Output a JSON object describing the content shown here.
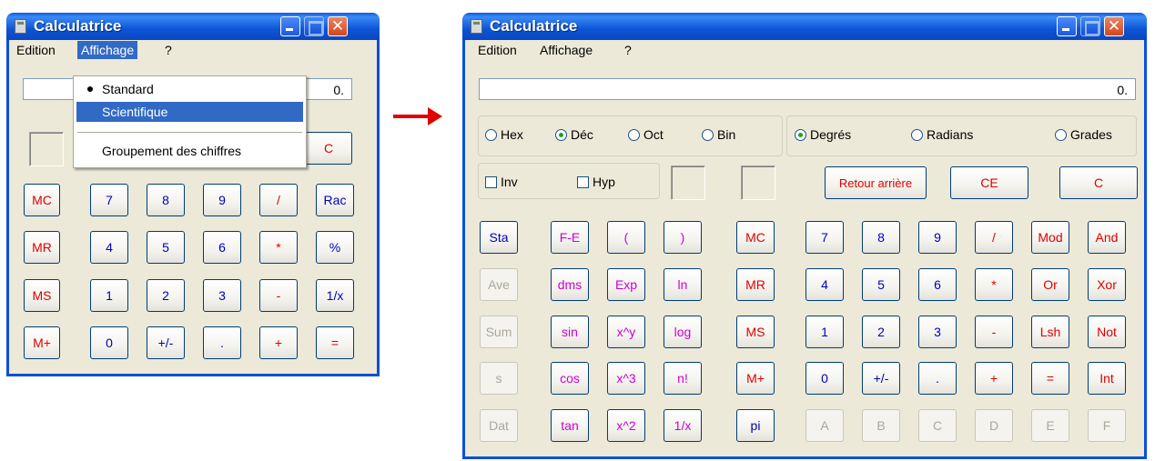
{
  "left": {
    "title": "Calculatrice",
    "menu": [
      "Edition",
      "Affichage",
      "?"
    ],
    "display": "0.",
    "clear": "C",
    "dropdown": {
      "items": [
        "Standard",
        "Scientifique",
        "Groupement des chiffres"
      ]
    },
    "rows": [
      [
        "MC",
        "7",
        "8",
        "9",
        "/",
        "Rac"
      ],
      [
        "MR",
        "4",
        "5",
        "6",
        "*",
        "%"
      ],
      [
        "MS",
        "1",
        "2",
        "3",
        "-",
        "1/x"
      ],
      [
        "M+",
        "0",
        "+/-",
        ".",
        "+",
        "="
      ]
    ]
  },
  "right": {
    "title": "Calculatrice",
    "menu": [
      "Edition",
      "Affichage",
      "?"
    ],
    "display": "0.",
    "bases": [
      "Hex",
      "Déc",
      "Oct",
      "Bin"
    ],
    "angles": [
      "Degrés",
      "Radians",
      "Grades"
    ],
    "inv": "Inv",
    "hyp": "Hyp",
    "back": "Retour arrière",
    "ce": "CE",
    "c": "C",
    "stat": [
      "Sta",
      "Ave",
      "Sum",
      "s",
      "Dat"
    ],
    "fcol1": [
      "F-E",
      "dms",
      "sin",
      "cos",
      "tan"
    ],
    "fcol2": [
      "(",
      "Exp",
      "x^y",
      "x^3",
      "x^2"
    ],
    "fcol3": [
      ")",
      "ln",
      "log",
      "n!",
      "1/x"
    ],
    "mem": [
      "MC",
      "MR",
      "MS",
      "M+",
      "pi"
    ],
    "pad": [
      [
        "7",
        "8",
        "9",
        "/",
        "Mod",
        "And"
      ],
      [
        "4",
        "5",
        "6",
        "*",
        "Or",
        "Xor"
      ],
      [
        "1",
        "2",
        "3",
        "-",
        "Lsh",
        "Not"
      ],
      [
        "0",
        "+/-",
        ".",
        "+",
        "=",
        "Int"
      ],
      [
        "A",
        "B",
        "C",
        "D",
        "E",
        "F"
      ]
    ]
  },
  "colors": {
    "arrow": "#e00000",
    "accent": "#0a4fd8",
    "highlight": "#316ac5"
  }
}
